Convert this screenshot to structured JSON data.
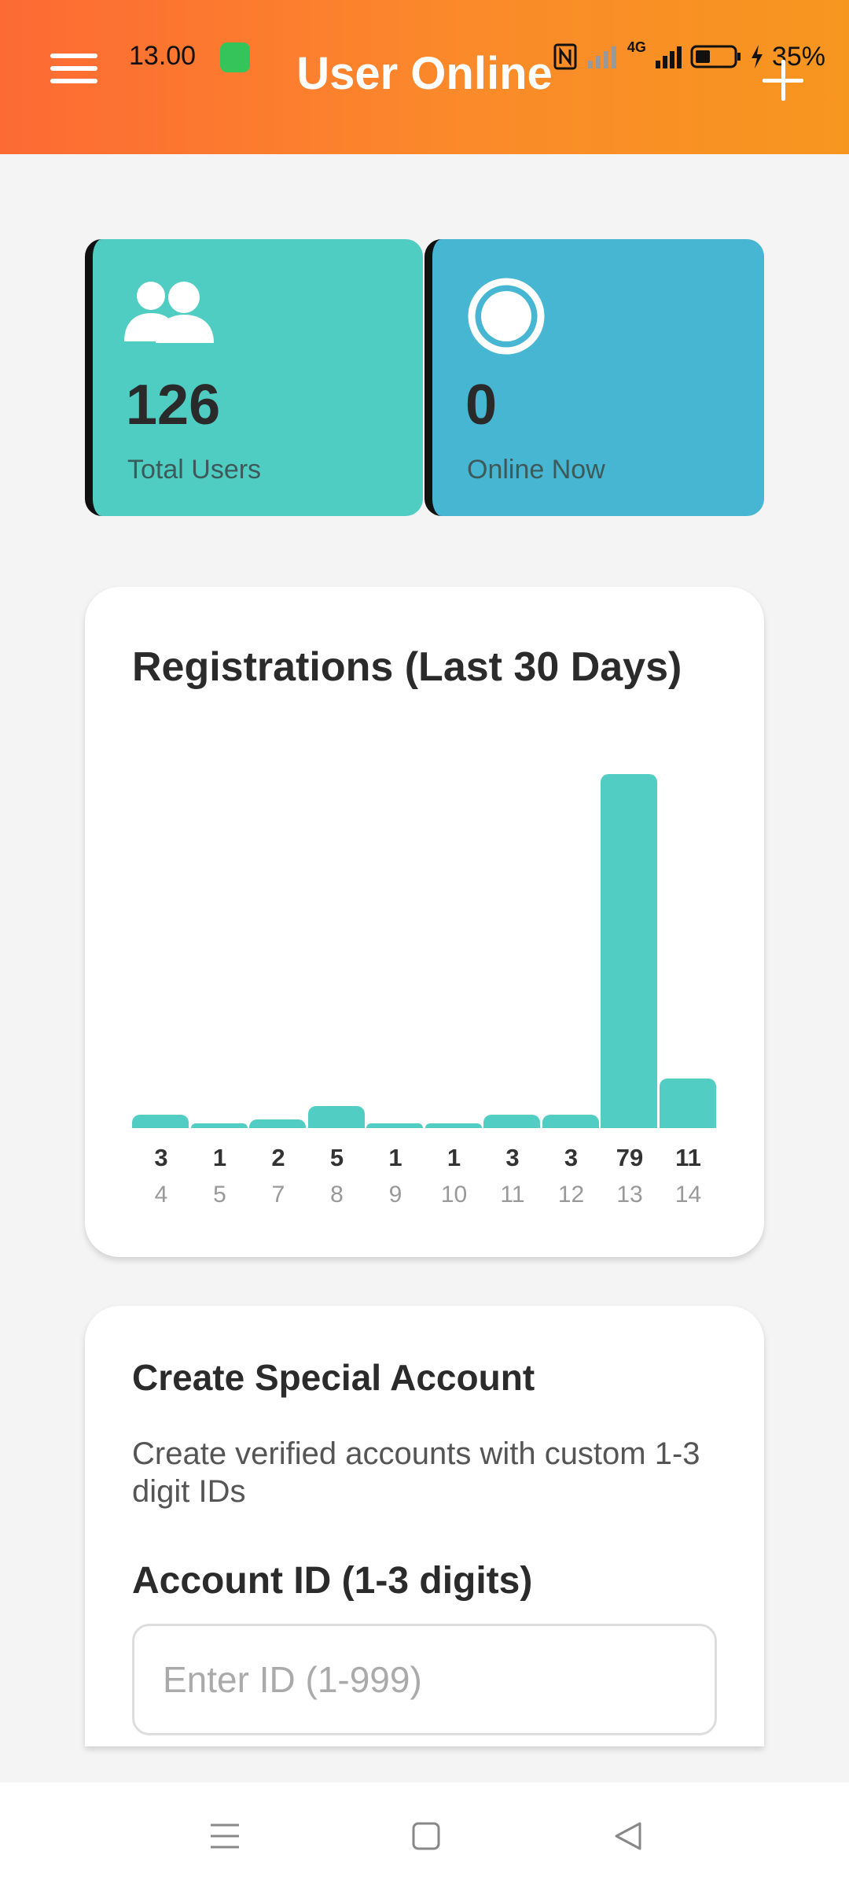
{
  "status_bar": {
    "time": "13.00",
    "network": "4G",
    "battery": "35%"
  },
  "header": {
    "title": "User Online"
  },
  "stats": {
    "total_users": {
      "value": "126",
      "label": "Total Users",
      "icon": "users-icon"
    },
    "online_now": {
      "value": "0",
      "label": "Online Now",
      "icon": "online-circle-icon"
    }
  },
  "chart": {
    "title": "Registrations (Last 30 Days)"
  },
  "chart_data": {
    "type": "bar",
    "title": "Registrations (Last 30 Days)",
    "categories": [
      "4",
      "5",
      "7",
      "8",
      "9",
      "10",
      "11",
      "12",
      "13",
      "14"
    ],
    "values": [
      3,
      1,
      2,
      5,
      1,
      1,
      3,
      3,
      79,
      11
    ],
    "bar_color": "#52cdc4",
    "xlabel": "",
    "ylabel": ""
  },
  "special_account": {
    "title": "Create Special Account",
    "description": "Create verified accounts with custom 1-3 digit IDs",
    "field_label": "Account ID (1-3 digits)",
    "placeholder": "Enter ID (1-999)",
    "value": ""
  },
  "colors": {
    "header_start": "#fd6a34",
    "header_end": "#f7961f",
    "teal": "#50cdc3",
    "blue": "#47b6d2"
  }
}
